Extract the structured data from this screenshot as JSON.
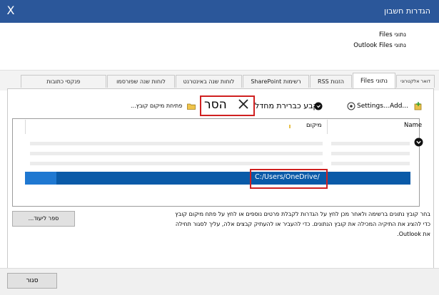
{
  "window": {
    "title": "הגדרות חשבון",
    "close_label": "X"
  },
  "header": {
    "line1": "נתוני Files",
    "line2": "נתוני Outlook Files"
  },
  "tabs": [
    {
      "label": "דואר אלקטרוני"
    },
    {
      "label": "נתוני Files"
    },
    {
      "label": "הזנות RSS"
    },
    {
      "label": "רשימות SharePoint"
    },
    {
      "label": "לוחות שנה באינטרנט"
    },
    {
      "label": "לוחות שנה שפורסמו"
    },
    {
      "label": "פנקסי כתובות"
    }
  ],
  "toolbar": {
    "add_label": "Add...",
    "settings_label": "Settings...",
    "set_default_label": "קבע כברירת מחדל",
    "remove_label": "הסר",
    "open_location_label": "פתיחת מיקום קובץ..."
  },
  "list": {
    "col_name": "Name",
    "col_location": "מיקום",
    "selected_path": "C:/Users/OneDrive/"
  },
  "description": {
    "line1": "בחר קובץ נתונים ברשימה ולאחר מכן לחץ על הגדרות לקבלת פרטים נוספים או לחץ על פתח מיקום קובץ",
    "line2": "כדי להציג את התיקיה המכילה את קובץ הנתונים. כדי להעביר או להעתיק קבצים אלה, עליך לסגור תחילה",
    "line3": "את Outlook."
  },
  "buttons": {
    "more_label": "ספר ליעוד...",
    "close_label": "סגור"
  },
  "colors": {
    "titlebar": "#2b579a",
    "selection": "#0a5aa8",
    "highlight_box": "#d02020"
  }
}
